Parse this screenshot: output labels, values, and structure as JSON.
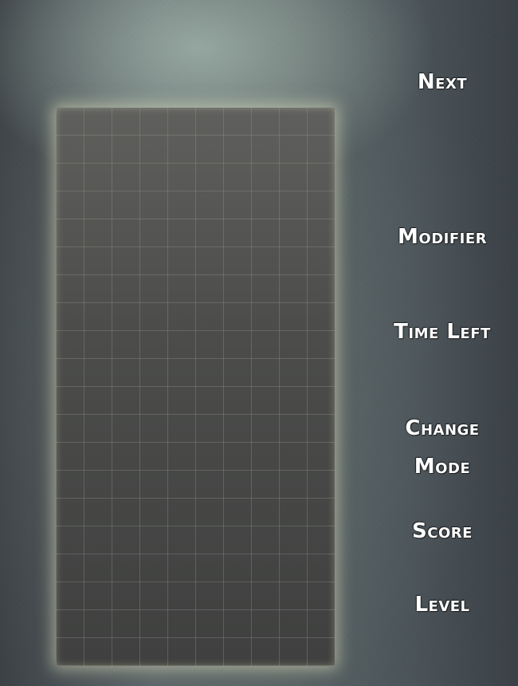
{
  "panel": {
    "next_label": "Next",
    "modifier_label": "Modifier",
    "time_left_label": "Time Left",
    "change_mode_line1": "Change",
    "change_mode_line2": "Mode",
    "score_label": "Score",
    "level_label": "Level"
  },
  "board": {
    "columns": 10,
    "rows": 20
  }
}
